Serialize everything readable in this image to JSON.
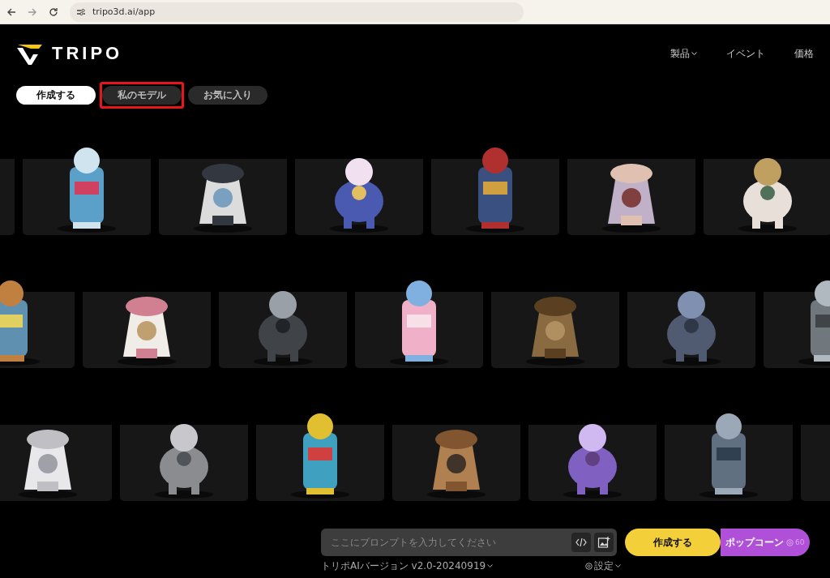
{
  "browser": {
    "url": "tripo3d.ai/app"
  },
  "header": {
    "logo": "TRIPO",
    "nav": [
      {
        "label": "製品",
        "dropdown": true
      },
      {
        "label": "イベント",
        "dropdown": false
      },
      {
        "label": "価格",
        "dropdown": false
      }
    ]
  },
  "tabs": [
    {
      "label": "作成する",
      "selected": true,
      "highlighted": false
    },
    {
      "label": "私のモデル",
      "selected": false,
      "highlighted": true
    },
    {
      "label": "お気に入り",
      "selected": false,
      "highlighted": false
    }
  ],
  "gallery": [
    {
      "cards": [
        {
          "kind": "empty"
        },
        {
          "kind": "picture"
        },
        {
          "kind": "picture"
        },
        {
          "kind": "picture"
        },
        {
          "kind": "picture"
        },
        {
          "kind": "picture"
        },
        {
          "kind": "picture"
        }
      ]
    },
    {
      "cards": [
        {
          "kind": "picture"
        },
        {
          "kind": "picture"
        },
        {
          "kind": "picture"
        },
        {
          "kind": "picture"
        },
        {
          "kind": "picture"
        },
        {
          "kind": "picture"
        },
        {
          "kind": "picture"
        }
      ]
    },
    {
      "cards": [
        {
          "kind": "picture"
        },
        {
          "kind": "picture"
        },
        {
          "kind": "picture"
        },
        {
          "kind": "picture"
        },
        {
          "kind": "picture"
        },
        {
          "kind": "picture"
        },
        {
          "kind": "empty"
        }
      ]
    }
  ],
  "prompt": {
    "placeholder": "ここにプロンプトを入力してください",
    "create_button": "作成する",
    "popcorn_button": "ポップコーン",
    "credits": "60",
    "version": "トリポAIバージョン v2.0-20240919",
    "settings": "設定"
  }
}
